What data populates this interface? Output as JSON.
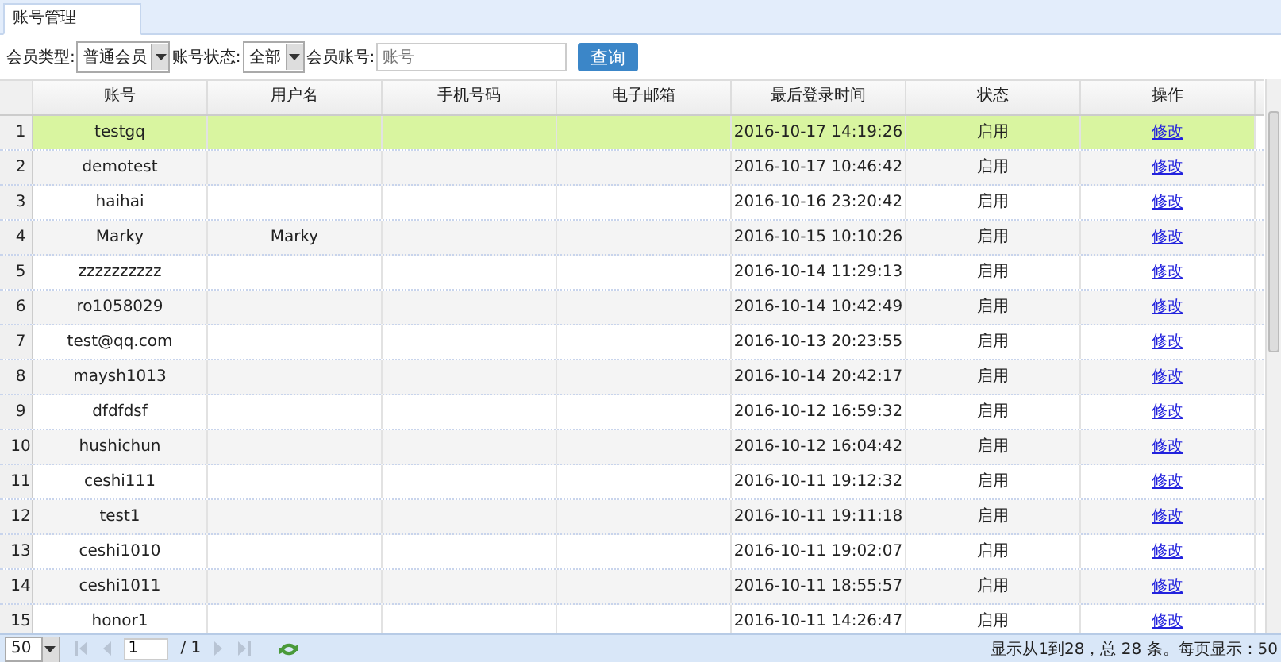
{
  "tabs": [
    {
      "label": "账号管理",
      "selected": true
    }
  ],
  "filters": [
    {
      "kind": "select",
      "label": "会员类型:",
      "value": "普通会员"
    },
    {
      "kind": "select",
      "label": "账号状态:",
      "value": "全部"
    },
    {
      "kind": "input",
      "label": "会员账号:",
      "placeholder": "账号"
    }
  ],
  "search_button": "查询",
  "table": {
    "columns": [
      "账号",
      "用户名",
      "手机号码",
      "电子邮箱",
      "最后登录时间",
      "状态",
      "操作"
    ],
    "rows": [
      {
        "index": "1",
        "account": "testgq",
        "username": "",
        "time": "2016-10-17 14:19:26",
        "status": "启用",
        "action": "修改",
        "selected": true
      },
      {
        "index": "2",
        "account": "demotest",
        "username": "",
        "time": "2016-10-17 10:46:42",
        "status": "启用",
        "action": "修改",
        "selected": false
      },
      {
        "index": "3",
        "account": "haihai",
        "username": "",
        "time": "2016-10-16 23:20:42",
        "status": "启用",
        "action": "修改",
        "selected": false
      },
      {
        "index": "4",
        "account": "Marky",
        "username": "Marky",
        "time": "2016-10-15 10:10:26",
        "status": "启用",
        "action": "修改",
        "selected": false
      },
      {
        "index": "5",
        "account": "zzzzzzzzzz",
        "username": "",
        "time": "2016-10-14 11:29:13",
        "status": "启用",
        "action": "修改",
        "selected": false
      },
      {
        "index": "6",
        "account": "ro1058029",
        "username": "",
        "time": "2016-10-14 10:42:49",
        "status": "启用",
        "action": "修改",
        "selected": false
      },
      {
        "index": "7",
        "account": "test@qq.com",
        "username": "",
        "time": "2016-10-13 20:23:55",
        "status": "启用",
        "action": "修改",
        "selected": false
      },
      {
        "index": "8",
        "account": "maysh1013",
        "username": "",
        "time": "2016-10-14 20:42:17",
        "status": "启用",
        "action": "修改",
        "selected": false
      },
      {
        "index": "9",
        "account": "dfdfdsf",
        "username": "",
        "time": "2016-10-12 16:59:32",
        "status": "启用",
        "action": "修改",
        "selected": false
      },
      {
        "index": "10",
        "account": "hushichun",
        "username": "",
        "time": "2016-10-12 16:04:42",
        "status": "启用",
        "action": "修改",
        "selected": false
      },
      {
        "index": "11",
        "account": "ceshi111",
        "username": "",
        "time": "2016-10-11 19:12:32",
        "status": "启用",
        "action": "修改",
        "selected": false
      },
      {
        "index": "12",
        "account": "test1",
        "username": "",
        "time": "2016-10-11 19:11:18",
        "status": "启用",
        "action": "修改",
        "selected": false
      },
      {
        "index": "13",
        "account": "ceshi1010",
        "username": "",
        "time": "2016-10-11 19:02:07",
        "status": "启用",
        "action": "修改",
        "selected": false
      },
      {
        "index": "14",
        "account": "ceshi1011",
        "username": "",
        "time": "2016-10-11 18:55:57",
        "status": "启用",
        "action": "修改",
        "selected": false
      },
      {
        "index": "15",
        "account": "honor1",
        "username": "",
        "time": "2016-10-11 14:26:47",
        "status": "启用",
        "action": "修改",
        "selected": false
      }
    ]
  },
  "pager": {
    "page_size": "50",
    "page": "1",
    "total_pages": "/ 1",
    "summary": "显示从1到28，总 28 条。每页显示：50"
  }
}
